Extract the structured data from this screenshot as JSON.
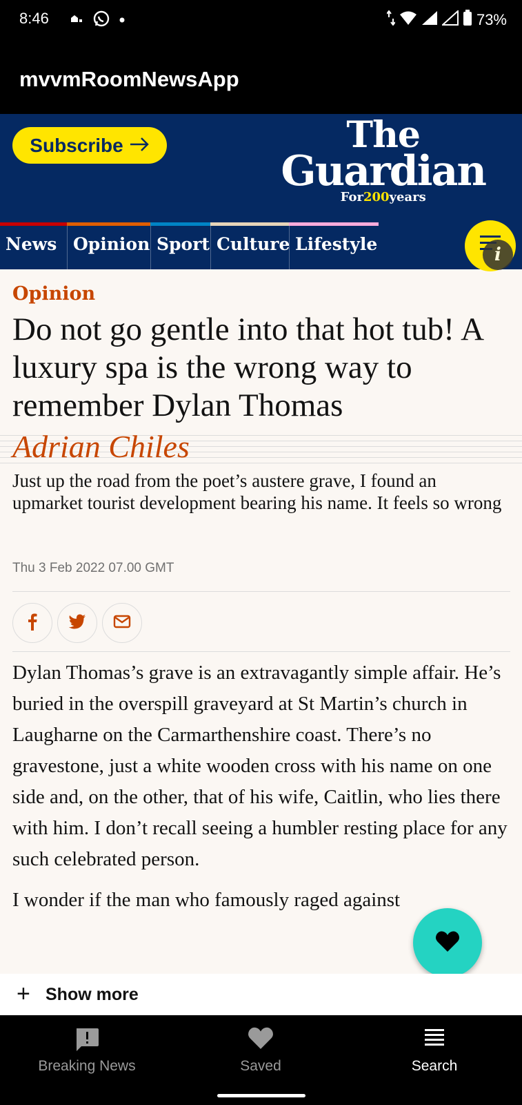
{
  "status_bar": {
    "time": "8:46",
    "battery": "73%"
  },
  "app": {
    "title": "mvvmRoomNewsApp"
  },
  "masthead": {
    "subscribe_label": "Subscribe",
    "logo_line1": "The",
    "logo_line2": "Guardian",
    "logo_tag_prefix": "For",
    "logo_tag_years": "200",
    "logo_tag_suffix": "years"
  },
  "nav": {
    "items": [
      {
        "label": "News",
        "color": "#c70000"
      },
      {
        "label": "Opinion",
        "color": "#e05e00"
      },
      {
        "label": "Sport",
        "color": "#0084c6"
      },
      {
        "label": "Culture",
        "color": "#a1845c"
      },
      {
        "label": "Lifestyle",
        "color": "#bb3b80"
      }
    ]
  },
  "article": {
    "kicker": "Opinion",
    "headline": "Do not go gentle into that hot tub! A luxury spa is the wrong way to remember Dylan Thomas",
    "byline": "Adrian Chiles",
    "standfirst": "Just up the road from the poet’s austere grave, I found an upmarket tourist development bearing his name. It feels so wrong",
    "date": "Thu 3 Feb 2022 07.00 GMT",
    "paragraphs": [
      "Dylan Thomas’s grave is an extravagantly simple affair. He’s buried in the overspill graveyard at St Martin’s church in Laugharne on the Carmarthenshire coast. There’s no gravestone, just a white wooden cross with his name on one side and, on the other, that of his wife, Caitlin, who lies there with him. I don’t recall seeing a humbler resting place for any such celebrated person.",
      "I wonder if the man who famously raged against"
    ]
  },
  "show_more": {
    "label": "Show more"
  },
  "bottom_nav": {
    "items": [
      {
        "label": "Breaking News"
      },
      {
        "label": "Saved"
      },
      {
        "label": "Search"
      }
    ]
  },
  "colors": {
    "guardian_blue": "#052962",
    "brand_yellow": "#ffe500",
    "opinion_orange": "#c74600",
    "fab_teal": "#24d3c2"
  }
}
